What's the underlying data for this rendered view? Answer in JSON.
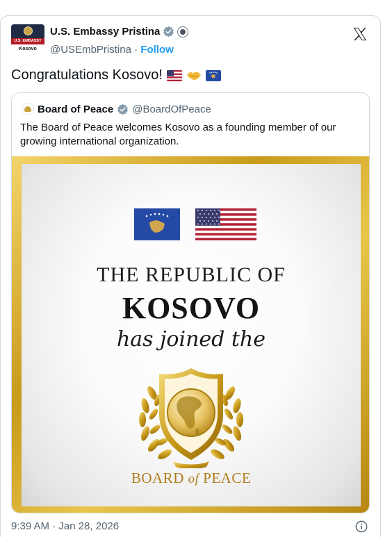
{
  "author": {
    "avatar_band": "U.S. EMBASSY",
    "avatar_city": "Kosovo",
    "name": "U.S. Embassy Pristina",
    "handle": "@USEmbPristina",
    "separator": "·",
    "follow_label": "Follow"
  },
  "tweet": {
    "text": "Congratulations Kosovo!",
    "timestamp": "9:39 AM · Jan 28, 2026"
  },
  "quote": {
    "name": "Board of Peace",
    "handle": "@BoardOfPeace",
    "text": "The Board of Peace welcomes Kosovo as a founding member of our growing international organization.",
    "image": {
      "line1": "THE REPUBLIC OF",
      "line2": "KOSOVO",
      "line3": "has joined the",
      "logo_text_1": "BOARD",
      "logo_text_of": "of",
      "logo_text_2": "PEACE"
    }
  },
  "colors": {
    "accent": "#1d9bf0",
    "gold": "#c99a1b",
    "kosovo_blue": "#244aa5",
    "us_red": "#b22234",
    "us_blue": "#3c3b6e"
  }
}
